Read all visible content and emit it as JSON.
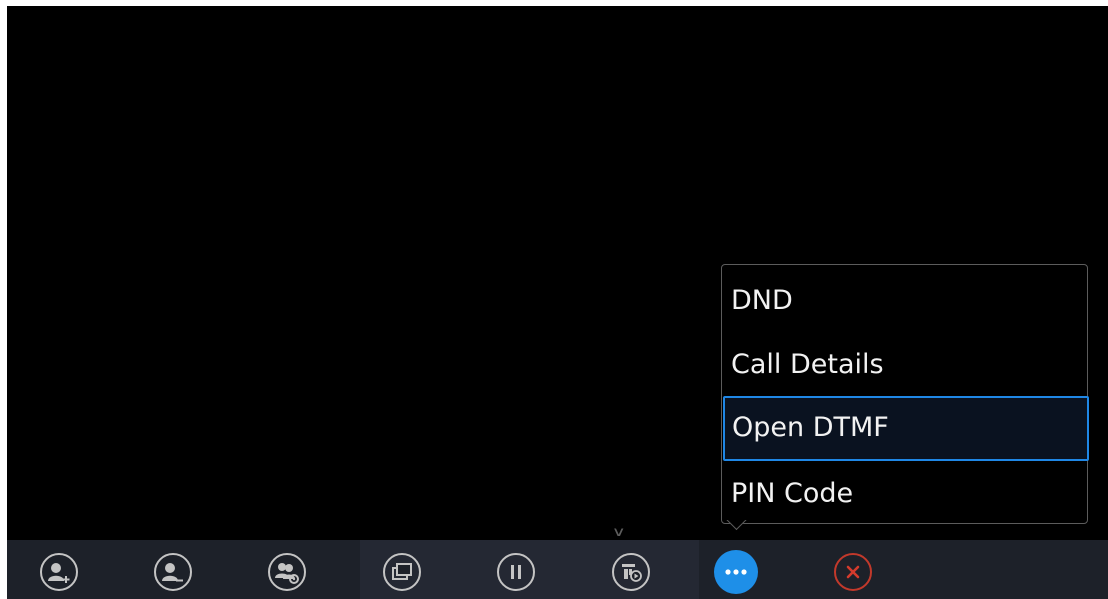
{
  "more_menu": {
    "items": [
      {
        "label": "DND"
      },
      {
        "label": "Call Details"
      },
      {
        "label": "Open DTMF",
        "selected": true
      },
      {
        "label": "PIN Code"
      }
    ]
  },
  "toolbar": {
    "buttons": [
      {
        "icon": "add-participant-icon"
      },
      {
        "icon": "remove-participant-icon"
      },
      {
        "icon": "conference-settings-icon"
      },
      {
        "icon": "layout-window-icon"
      },
      {
        "icon": "pause-icon"
      },
      {
        "icon": "record-icon"
      },
      {
        "icon": "more-icon"
      },
      {
        "icon": "end-call-icon"
      }
    ]
  },
  "colors": {
    "accent": "#1e8fe8",
    "end_call": "#c2392b",
    "toolbar_bg": "#1d2129"
  }
}
